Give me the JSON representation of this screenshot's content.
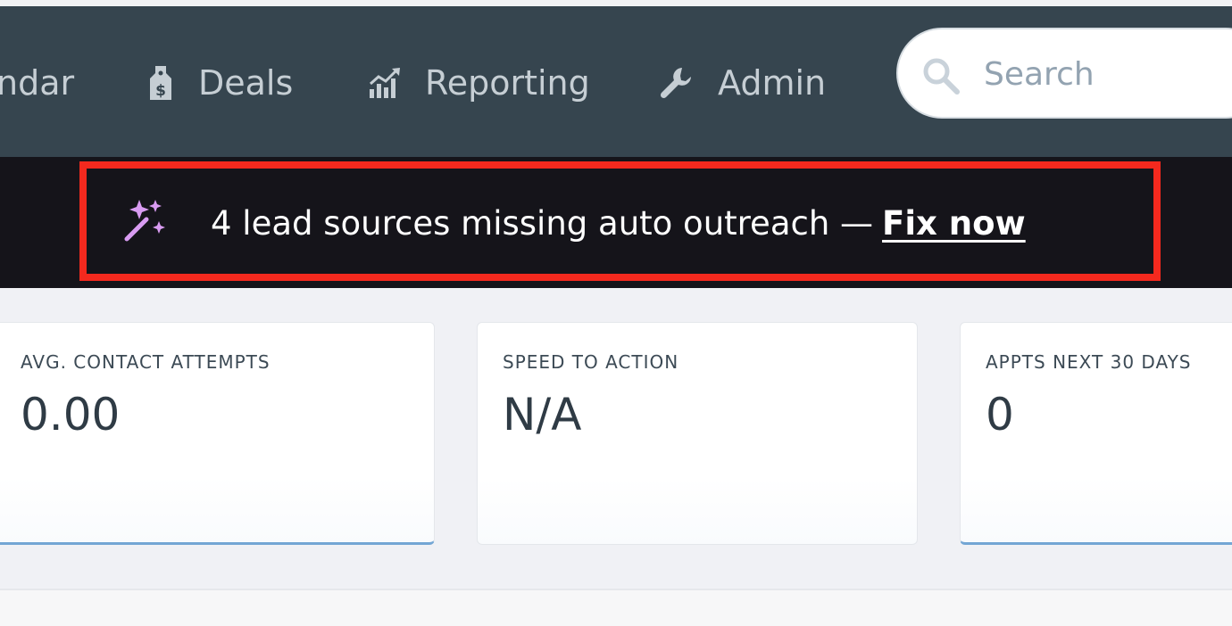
{
  "nav": {
    "items": [
      {
        "label": "ndar",
        "icon": "calendar-icon"
      },
      {
        "label": "Deals",
        "icon": "money-tag-icon"
      },
      {
        "label": "Reporting",
        "icon": "chart-up-icon"
      },
      {
        "label": "Admin",
        "icon": "wrench-icon"
      }
    ]
  },
  "search": {
    "placeholder": "Search",
    "icon": "search-icon"
  },
  "banner": {
    "message": "4 lead sources missing auto outreach —",
    "link": "Fix now",
    "icon": "magic-wand-icon",
    "highlight_color": "#f4291e"
  },
  "cards": [
    {
      "label": "AVG. CONTACT ATTEMPTS",
      "value": "0.00"
    },
    {
      "label": "SPEED TO ACTION",
      "value": "N/A"
    },
    {
      "label": "APPTS NEXT 30 DAYS",
      "value": "0"
    }
  ],
  "colors": {
    "navbar": "#36454f",
    "banner": "#15141a",
    "accent": "#73a6d4",
    "wand": "#d99cf2"
  }
}
